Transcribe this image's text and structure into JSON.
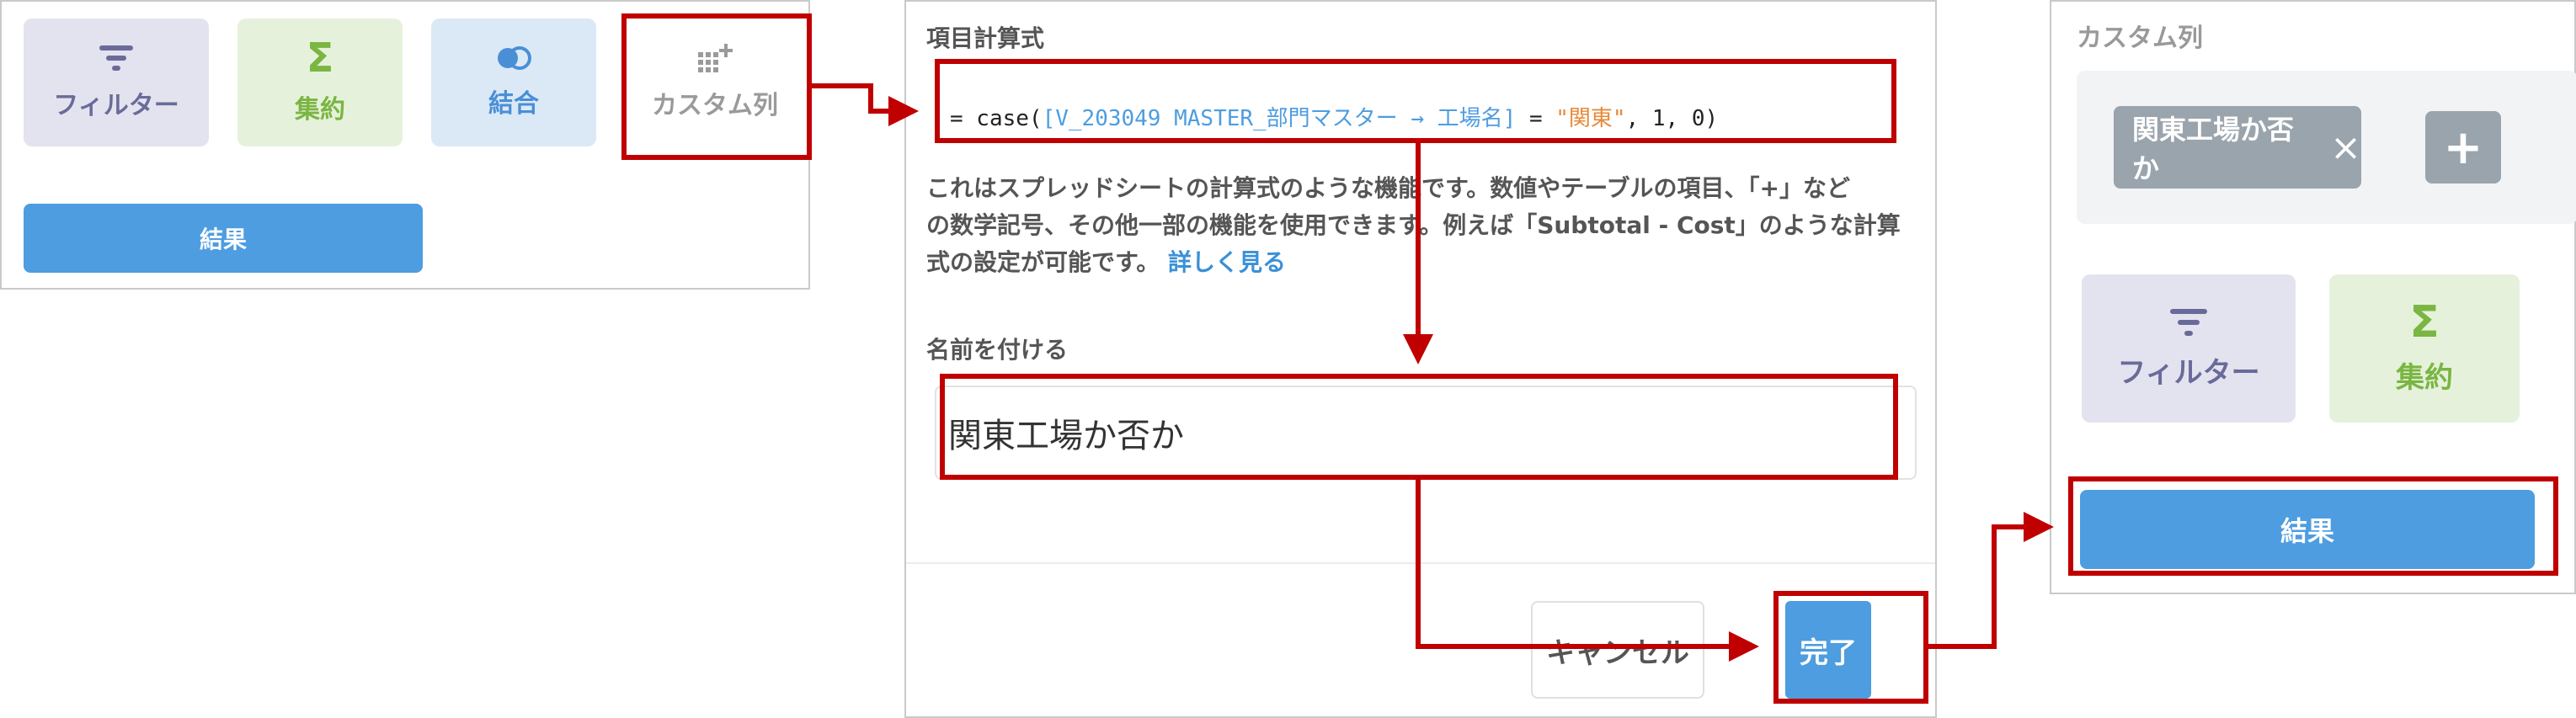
{
  "left_panel": {
    "tiles": {
      "filter": "フィルター",
      "summary": "集約",
      "join": "結合",
      "custom": "カスタム列"
    },
    "result_button": "結果"
  },
  "middle_panel": {
    "formula_section_title": "項目計算式",
    "formula": {
      "prefix": "= case(",
      "field_ref": "[V_203049 MASTER_部門マスター → 工場名]",
      "operator": " = ",
      "string_value": "\"関東\"",
      "suffix": ", 1, 0)"
    },
    "description_line1": "これはスプレッドシートの計算式のような機能です。数値やテーブルの項目、「+」など",
    "description_line2": "の数学記号、その他一部の機能を使用できます。例えば「Subtotal - Cost」のような計算",
    "description_line3": "式の設定が可能です。",
    "learn_more_link": "詳しく見る",
    "name_section_title": "名前を付ける",
    "name_input_value": "関東工場か否か",
    "cancel_button": "キャンセル",
    "done_button": "完了"
  },
  "right_panel": {
    "title": "カスタム列",
    "chip_label": "関東工場か否か",
    "chip_close": "×",
    "add_button": "+",
    "tiles": {
      "filter": "フィルター",
      "summary": "集約"
    },
    "result_button": "結果"
  },
  "colors": {
    "highlight_red": "#c00000",
    "primary_blue": "#4d9de0",
    "filter_tile": "#e3e3ef",
    "summary_tile": "#e6f1db",
    "join_tile": "#dbe9f7"
  }
}
